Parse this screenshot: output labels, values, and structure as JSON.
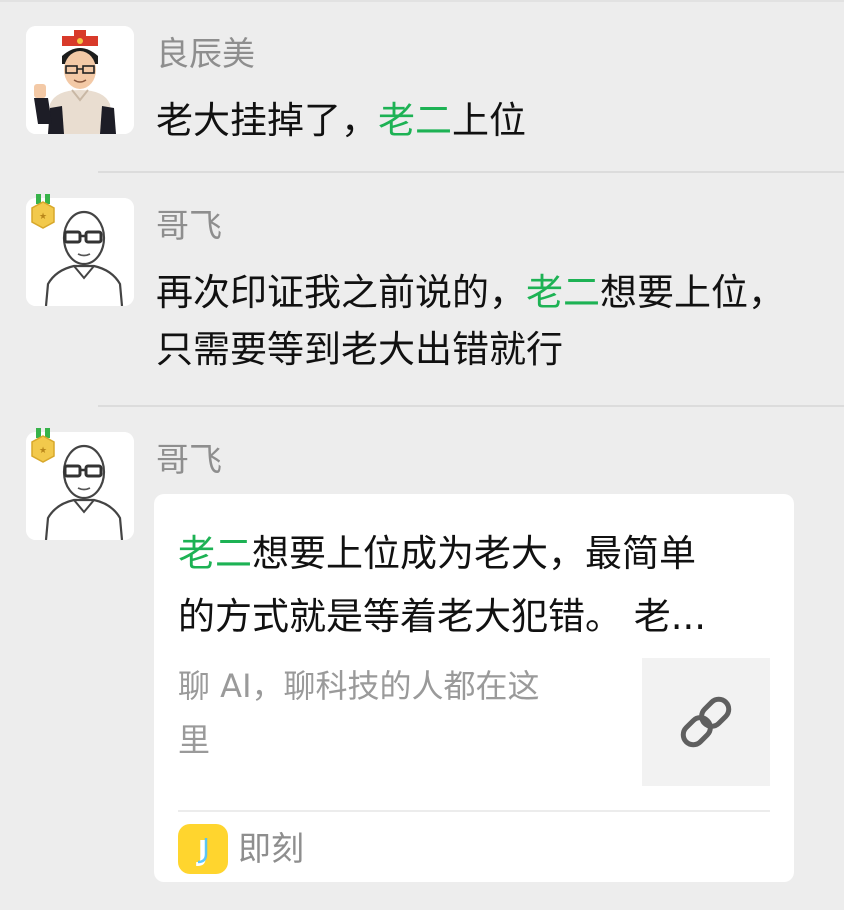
{
  "messages": [
    {
      "sender": "良辰美",
      "text": [
        "老大挂掉了，",
        "老二",
        "上位"
      ]
    },
    {
      "sender": "哥飞",
      "lines": [
        [
          "再次印证我之前说的，",
          "老二",
          "想要上位，"
        ],
        [
          "只需要等到老大出错就行"
        ]
      ]
    },
    {
      "sender": "哥飞",
      "card": {
        "title_line1": [
          "老二",
          "想要上位成为老大，最简单"
        ],
        "title_line2": "的方式就是等着老大犯错。 老...",
        "desc_line1": "聊 AI，聊科技的人都在这",
        "desc_line2": "里",
        "thumb_icon": "link-icon",
        "app_icon": "jike-app-icon",
        "app_icon_letter": "J",
        "app_name": "即刻"
      }
    }
  ],
  "colors": {
    "background": "#ededed",
    "highlight": "#1db254",
    "card": "#ffffff",
    "app_icon": "#ffd52e"
  }
}
